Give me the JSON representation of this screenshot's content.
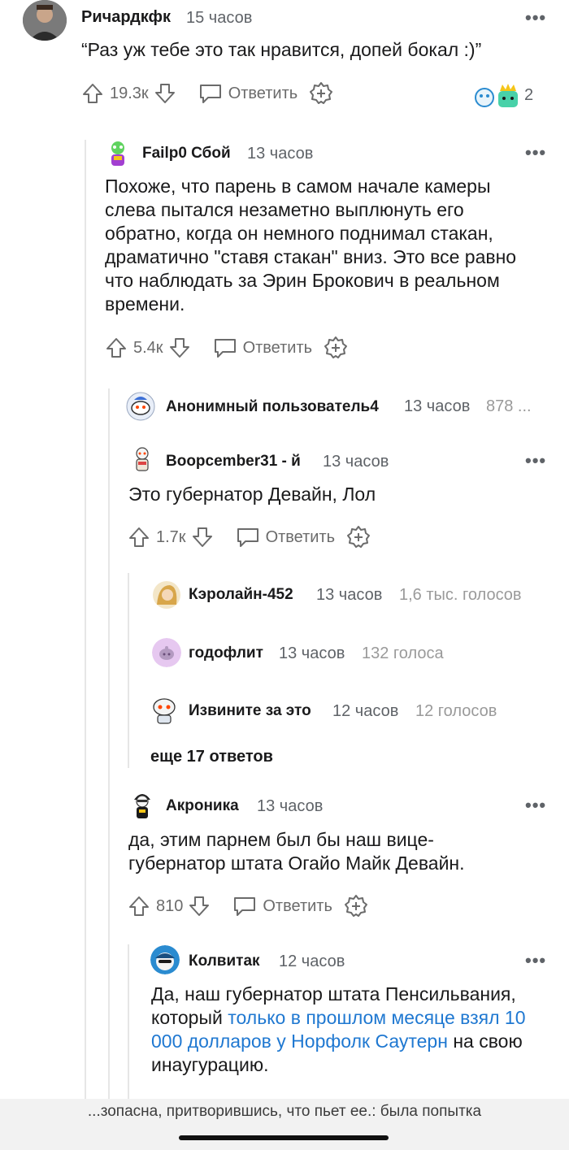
{
  "comments": {
    "c1": {
      "user": "Ричардкфк",
      "time": "15 часов",
      "text": "“Раз уж тебе это так нравится, допей бокал :)”",
      "up": "19.3к",
      "reply": "Ответить",
      "awards_count": "2"
    },
    "c2": {
      "user": "Failp0 Сбой",
      "time": "13 часов",
      "text": "Похоже, что парень в самом начале камеры слева пытался незаметно выплюнуть его обратно, когда он немного поднимал стакан, драматично \"ставя стакан\" вниз. Это все равно что наблюдать за Эрин Брокович в реальном времени.",
      "up": "5.4к",
      "reply": "Ответить"
    },
    "c3": {
      "user": "Анонимный пользователь4",
      "time": "13 часов",
      "votes": "878 ..."
    },
    "c4": {
      "user": "Boopcember31 - й",
      "time": "13 часов",
      "text": "Это губернатор Девайн, Лол",
      "up": "1.7к",
      "reply": "Ответить"
    },
    "c5": {
      "user": "Кэролайн-452",
      "time": "13 часов",
      "votes": "1,6 тыс. голосов"
    },
    "c6": {
      "user": "годофлит",
      "time": "13 часов",
      "votes": "132 голоса"
    },
    "c7": {
      "user": "Извините за это",
      "time": "12 часов",
      "votes": "12 голосов"
    },
    "more": "еще 17 ответов",
    "c8": {
      "user": "Акроника",
      "time": "13 часов",
      "text": "да, этим парнем был бы наш вице-губернатор штата Огайо Майк Девайн.",
      "up": "810",
      "reply": "Ответить"
    },
    "c9": {
      "user": "Колвитак",
      "time": "12 часов",
      "text_before": "Да, наш губернатор штата Пенсильвания, который ",
      "link": "только в прошлом месяце взял 10 000 долларов у Норфолк Саутерн",
      "text_after": " на свою инаугурацию."
    }
  },
  "bottom_bar": {
    "title": "...зопасна, притворившись, что пьет ее.: была попытка"
  },
  "colors": {
    "link": "#1f78d1",
    "text": "#1a1a1b",
    "muted": "#6b6b6b"
  }
}
